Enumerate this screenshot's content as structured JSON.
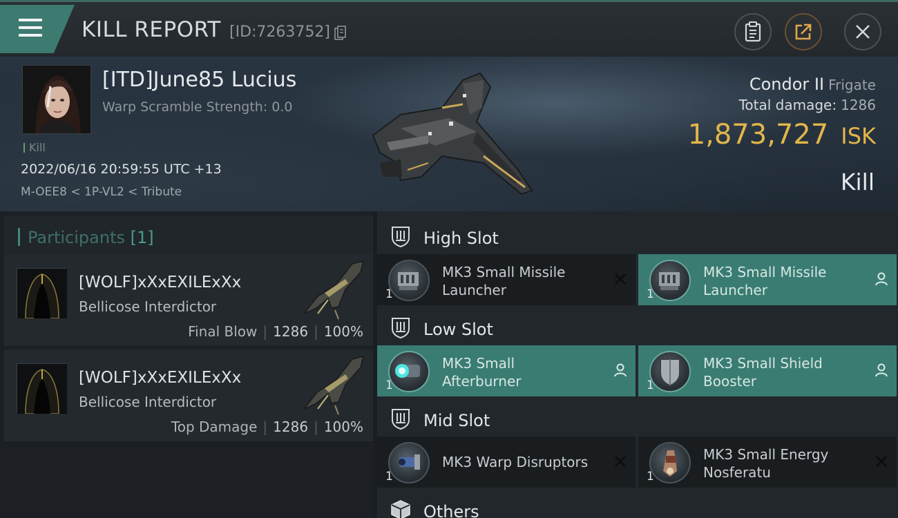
{
  "header": {
    "title": "KILL REPORT",
    "report_id": "[ID:7263752]"
  },
  "victim": {
    "name": "[ITD]June85 Lucius",
    "warp_scramble": "Warp Scramble Strength: 0.0",
    "tag": "Kill",
    "datetime": "2022/06/16 20:59:55 UTC +13",
    "location": "M-OEE8 < 1P-VL2 < Tribute"
  },
  "ship": {
    "name": "Condor II",
    "class": "Frigate",
    "total_damage_label": "Total damage:",
    "total_damage": "1286",
    "isk_value": "1,873,727",
    "isk_unit": "ISK",
    "result": "Kill"
  },
  "participants": {
    "label": "Participants",
    "count": "[1]",
    "rows": [
      {
        "name": "[WOLF]xXxEXILExXx",
        "ship": "Bellicose Interdictor",
        "role": "Final Blow",
        "damage": "1286",
        "percent": "100%"
      },
      {
        "name": "[WOLF]xXxEXILExXx",
        "ship": "Bellicose Interdictor",
        "role": "Top Damage",
        "damage": "1286",
        "percent": "100%"
      }
    ],
    "separator": "|"
  },
  "fitting": {
    "high_slot": {
      "label": "High Slot",
      "modules": [
        {
          "name_line1": "MK3 Small Missile",
          "name_line2": "Launcher",
          "qty": "1",
          "status_icon": "destroyed-x-icon",
          "dropped": false
        },
        {
          "name_line1": "MK3 Small Missile",
          "name_line2": "Launcher",
          "qty": "1",
          "status_icon": "dropped-person-icon",
          "dropped": true
        }
      ]
    },
    "low_slot": {
      "label": "Low Slot",
      "modules": [
        {
          "name_line1": "MK3 Small",
          "name_line2": "Afterburner",
          "qty": "1",
          "status_icon": "dropped-person-icon",
          "dropped": true
        },
        {
          "name_line1": "MK3 Small Shield",
          "name_line2": "Booster",
          "qty": "1",
          "status_icon": "dropped-person-icon",
          "dropped": true
        }
      ]
    },
    "mid_slot": {
      "label": "Mid Slot",
      "modules": [
        {
          "name_line1": "MK3 Warp Disruptors",
          "name_line2": "",
          "qty": "1",
          "status_icon": "destroyed-x-icon",
          "dropped": false
        },
        {
          "name_line1": "MK3 Small Energy",
          "name_line2": "Nosferatu",
          "qty": "1",
          "status_icon": "destroyed-x-icon",
          "dropped": false
        }
      ]
    },
    "others": {
      "label": "Others"
    }
  },
  "colors": {
    "accent_teal": "#3a7c72",
    "isk_gold": "#e3b64a",
    "background": "#1a1e22"
  }
}
